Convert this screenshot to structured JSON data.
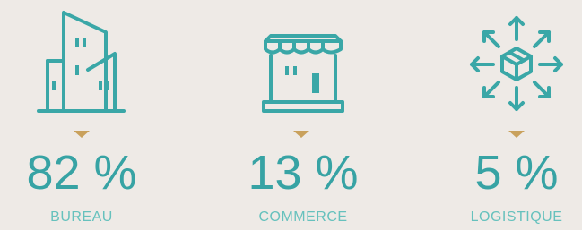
{
  "stats": [
    {
      "value": "82 %",
      "label": "BUREAU",
      "icon": "office-building-icon"
    },
    {
      "value": "13 %",
      "label": "COMMERCE",
      "icon": "storefront-icon"
    },
    {
      "value": "5 %",
      "label": "LOGISTIQUE",
      "icon": "logistics-box-arrows-icon"
    }
  ],
  "colors": {
    "accent": "#37a3a4",
    "label": "#66c1bd",
    "marker": "#c9a15c",
    "background": "#eeeae6"
  }
}
